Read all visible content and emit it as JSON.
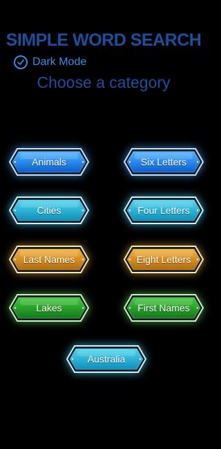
{
  "title": "SIMPLE WORD SEARCH",
  "dark_mode": {
    "label": "Dark Mode",
    "checked": true,
    "icon": "checkmark-icon"
  },
  "subtitle": "Choose a category",
  "categories": [
    {
      "label": "Animals",
      "color": "blue"
    },
    {
      "label": "Six Letters",
      "color": "blue"
    },
    {
      "label": "Cities",
      "color": "cyan"
    },
    {
      "label": "Four Letters",
      "color": "cyan"
    },
    {
      "label": "Last Names",
      "color": "orange"
    },
    {
      "label": "Eight Letters",
      "color": "orange"
    },
    {
      "label": "Lakes",
      "color": "green"
    },
    {
      "label": "First Names",
      "color": "green"
    },
    {
      "label": "Australia",
      "color": "cyan"
    }
  ],
  "colors": {
    "blue": {
      "top": "#4fb3ff",
      "bottom": "#0a5fd0",
      "border": "#bfe4ff"
    },
    "cyan": {
      "top": "#4fd6f0",
      "bottom": "#0d8fb8",
      "border": "#c8f4ff"
    },
    "orange": {
      "top": "#f2b33a",
      "bottom": "#b36a0c",
      "border": "#ffe6a8"
    },
    "green": {
      "top": "#42c83c",
      "bottom": "#127a18",
      "border": "#c7f5b8"
    }
  }
}
